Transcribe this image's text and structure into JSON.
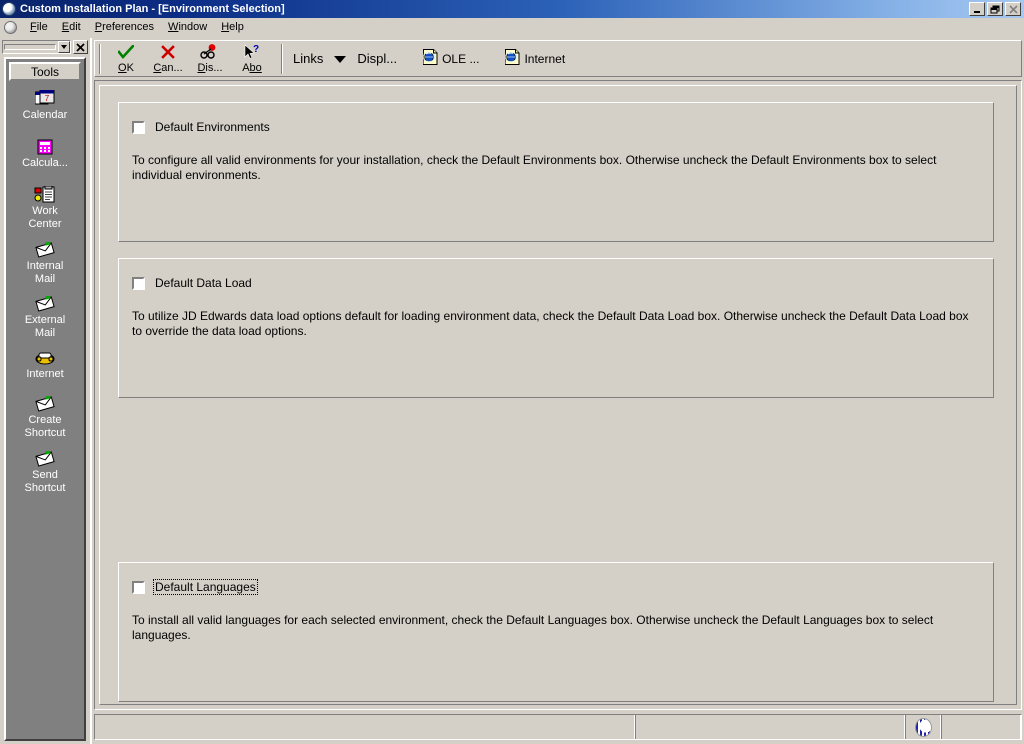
{
  "window": {
    "title": "Custom Installation Plan - [Environment Selection]",
    "logo_icon": "jde-sphere-icon",
    "buttons": {
      "minimize": "_",
      "restore": "❐",
      "close": "✕"
    }
  },
  "menubar": {
    "logo_icon": "jde-sphere-icon",
    "items": [
      {
        "label": "File",
        "accel": "F"
      },
      {
        "label": "Edit",
        "accel": "E"
      },
      {
        "label": "Preferences",
        "accel": "P"
      },
      {
        "label": "Window",
        "accel": "W"
      },
      {
        "label": "Help",
        "accel": "H"
      }
    ],
    "child_buttons": {
      "minimize": "_",
      "restore": "❐",
      "close": "✕"
    }
  },
  "sidebar": {
    "combo_value": "",
    "close_label": "✖",
    "header": "Tools",
    "items": [
      {
        "label": "Calendar",
        "icon": "calendar-icon"
      },
      {
        "label": "Calcula...",
        "icon": "calculator-icon"
      },
      {
        "label": "Work\nCenter",
        "icon": "work-center-icon"
      },
      {
        "label": "Internal\nMail",
        "icon": "envelope-icon"
      },
      {
        "label": "External\nMail",
        "icon": "envelope-icon"
      },
      {
        "label": "Internet",
        "icon": "phone-icon"
      },
      {
        "label": "Create\nShortcut",
        "icon": "envelope-icon"
      },
      {
        "label": "Send\nShortcut",
        "icon": "envelope-icon"
      }
    ]
  },
  "toolbar": {
    "buttons": [
      {
        "label": "OK",
        "accel_pre": "",
        "accel": "O",
        "accel_post": "K",
        "icon": "green-check-icon"
      },
      {
        "label": "Can...",
        "accel_pre": "",
        "accel": "C",
        "accel_post": "an...",
        "icon": "red-x-icon"
      },
      {
        "label": "Dis...",
        "accel_pre": "",
        "accel": "D",
        "accel_post": "is...",
        "icon": "glasses-icon"
      },
      {
        "label": "Abo",
        "accel_pre": "A",
        "accel": "bo",
        "accel_post": "",
        "icon": "help-cursor-icon"
      }
    ],
    "links_label": "Links",
    "links_arrow_icon": "chevron-down-icon",
    "display_label": "Displ...",
    "ole_label": "OLE ...",
    "ole_icon": "ole-document-icon",
    "internet_label": "Internet",
    "internet_icon": "internet-document-icon"
  },
  "form": {
    "groups": [
      {
        "id": "environments",
        "checkbox_label": "Default Environments",
        "checked": false,
        "focused": false,
        "description": "To configure all valid environments for your installation, check the Default Environments box.  Otherwise uncheck the Default Environments box to select individual environments."
      },
      {
        "id": "data-load",
        "checkbox_label": "Default Data Load",
        "checked": false,
        "focused": false,
        "description": "To utilize JD Edwards data load options default for loading environment data, check the Default Data Load box.  Otherwise uncheck the Default Data Load box to override the data load options."
      },
      {
        "id": "languages",
        "checkbox_label": "Default Languages",
        "checked": false,
        "focused": true,
        "description": "To install all valid languages for each selected environment, check the Default Languages box.  Otherwise uncheck the Default Languages box to select languages."
      }
    ]
  },
  "statusbar": {
    "pane1": "",
    "pane2": "",
    "pane3_icon": "jde-sphere-icon",
    "pane4": ""
  },
  "colors": {
    "face": "#d4d0c8",
    "title_start": "#0a246a",
    "title_end": "#a6c8f0",
    "sidebar_bg": "#808080",
    "check_green": "#008000",
    "cancel_red": "#cc0000"
  }
}
